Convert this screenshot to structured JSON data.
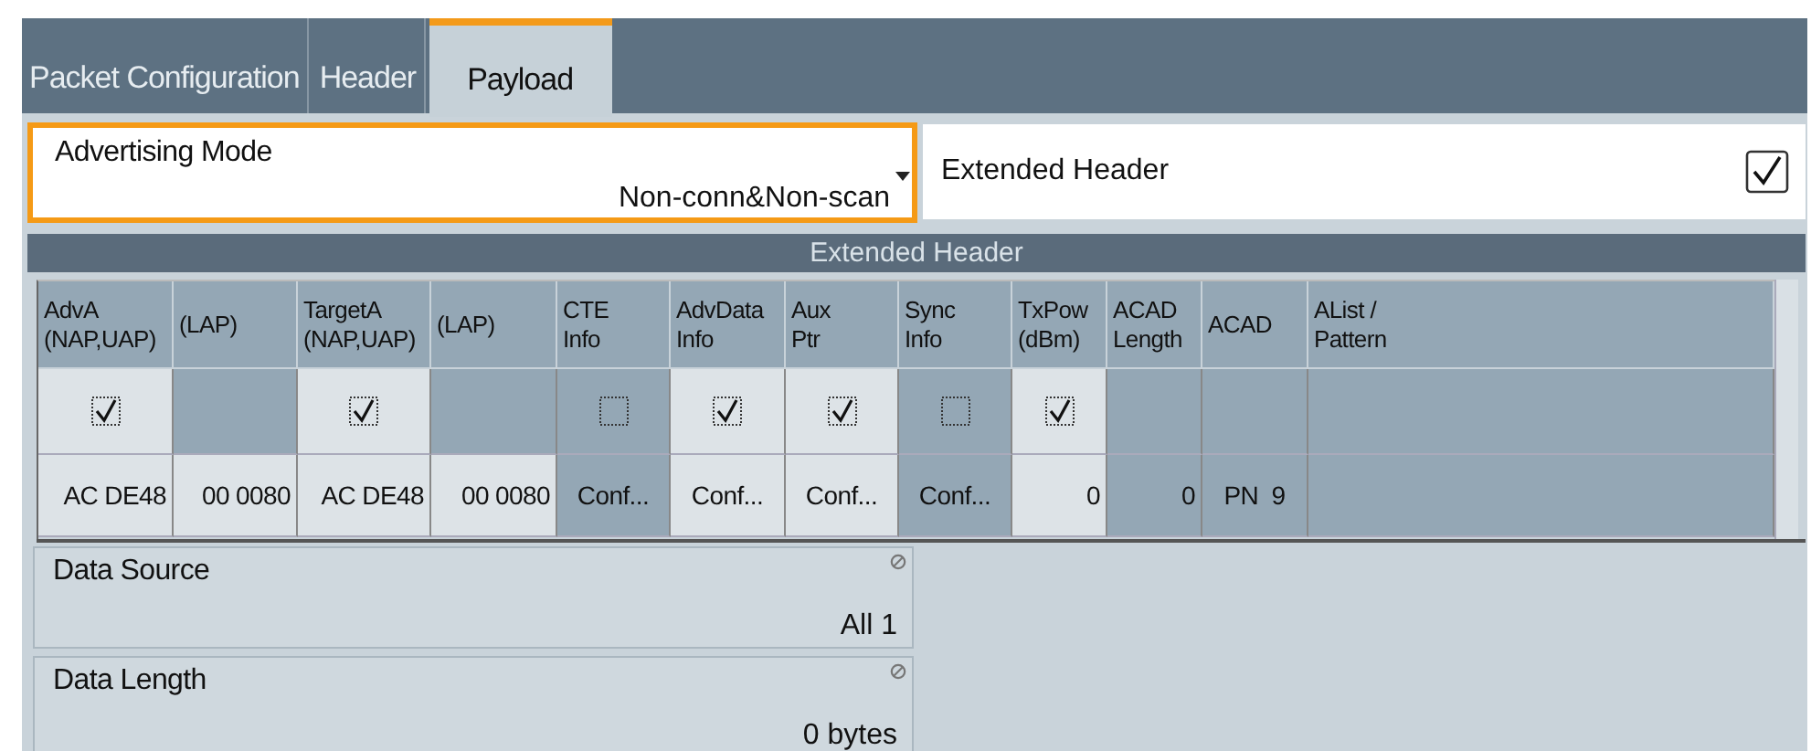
{
  "tabs": [
    {
      "label": "Packet Configuration",
      "selected": false
    },
    {
      "label": "Header",
      "selected": false
    },
    {
      "label": "Payload",
      "selected": true
    }
  ],
  "advertising_mode": {
    "label": "Advertising Mode",
    "value": "Non-conn&Non-scan",
    "focused": true
  },
  "extended_header_toggle": {
    "label": "Extended Header",
    "checked": true
  },
  "table": {
    "title": "Extended Header",
    "columns": [
      "AdvA\n(NAP,UAP)",
      "(LAP)",
      "TargetA\n(NAP,UAP)",
      "(LAP)",
      "CTE\nInfo",
      "AdvData\nInfo",
      "Aux\nPtr",
      "Sync\nInfo",
      "TxPow\n(dBm)",
      "ACAD\nLength",
      "ACAD",
      "AList /\nPattern"
    ],
    "rows": [
      [
        {
          "kind": "checkbox",
          "enabled": true,
          "checked": true
        },
        {
          "kind": "empty",
          "enabled": false
        },
        {
          "kind": "checkbox",
          "enabled": true,
          "checked": true
        },
        {
          "kind": "empty",
          "enabled": false
        },
        {
          "kind": "checkbox",
          "enabled": false,
          "checked": false
        },
        {
          "kind": "checkbox",
          "enabled": true,
          "checked": true
        },
        {
          "kind": "checkbox",
          "enabled": true,
          "checked": true
        },
        {
          "kind": "checkbox",
          "enabled": false,
          "checked": false
        },
        {
          "kind": "checkbox",
          "enabled": true,
          "checked": true
        },
        {
          "kind": "empty",
          "enabled": false
        },
        {
          "kind": "empty",
          "enabled": false
        },
        {
          "kind": "empty",
          "enabled": false
        }
      ],
      [
        {
          "kind": "number",
          "enabled": true,
          "text": "AC DE48"
        },
        {
          "kind": "number",
          "enabled": true,
          "text": "00 0080"
        },
        {
          "kind": "number",
          "enabled": true,
          "text": "AC DE48"
        },
        {
          "kind": "number",
          "enabled": true,
          "text": "00 0080"
        },
        {
          "kind": "button",
          "enabled": false,
          "text": "Conf..."
        },
        {
          "kind": "button",
          "enabled": true,
          "text": "Conf..."
        },
        {
          "kind": "button",
          "enabled": true,
          "text": "Conf..."
        },
        {
          "kind": "button",
          "enabled": false,
          "text": "Conf..."
        },
        {
          "kind": "number",
          "enabled": true,
          "text": "0"
        },
        {
          "kind": "number",
          "enabled": false,
          "text": "0"
        },
        {
          "kind": "text",
          "enabled": false,
          "text": "PN  9"
        },
        {
          "kind": "empty",
          "enabled": false
        }
      ]
    ]
  },
  "fields": [
    {
      "label": "Data Source",
      "value": "All 1"
    },
    {
      "label": "Data Length",
      "value": "0 bytes"
    }
  ]
}
